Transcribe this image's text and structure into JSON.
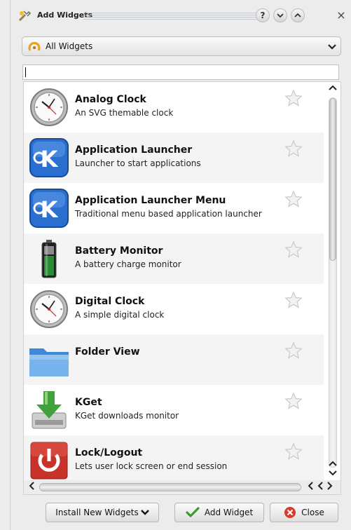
{
  "window": {
    "title": "Add Widgets",
    "help_button": "?",
    "close_icon": "×"
  },
  "category": {
    "selected": "All Widgets"
  },
  "search": {
    "value": ""
  },
  "widgets": [
    {
      "name": "Analog Clock",
      "description": "An SVG themable clock",
      "icon": "analog-clock-icon"
    },
    {
      "name": "Application Launcher",
      "description": "Launcher to start applications",
      "icon": "kde-launcher-icon"
    },
    {
      "name": "Application Launcher Menu",
      "description": "Traditional menu based application launcher",
      "icon": "kde-launcher-icon"
    },
    {
      "name": "Battery Monitor",
      "description": "A battery charge monitor",
      "icon": "battery-icon"
    },
    {
      "name": "Digital Clock",
      "description": "A simple digital clock",
      "icon": "analog-clock-icon"
    },
    {
      "name": "Folder View",
      "description": "",
      "icon": "folder-icon"
    },
    {
      "name": "KGet",
      "description": "KGet downloads monitor",
      "icon": "kget-download-icon"
    },
    {
      "name": "Lock/Logout",
      "description": "Lets user lock screen or end session",
      "icon": "power-icon"
    }
  ],
  "buttons": {
    "install": "Install New Widgets",
    "add": "Add Widget",
    "close": "Close"
  },
  "colors": {
    "accent_blue": "#2a6fd0",
    "close_red": "#d83a2c"
  }
}
